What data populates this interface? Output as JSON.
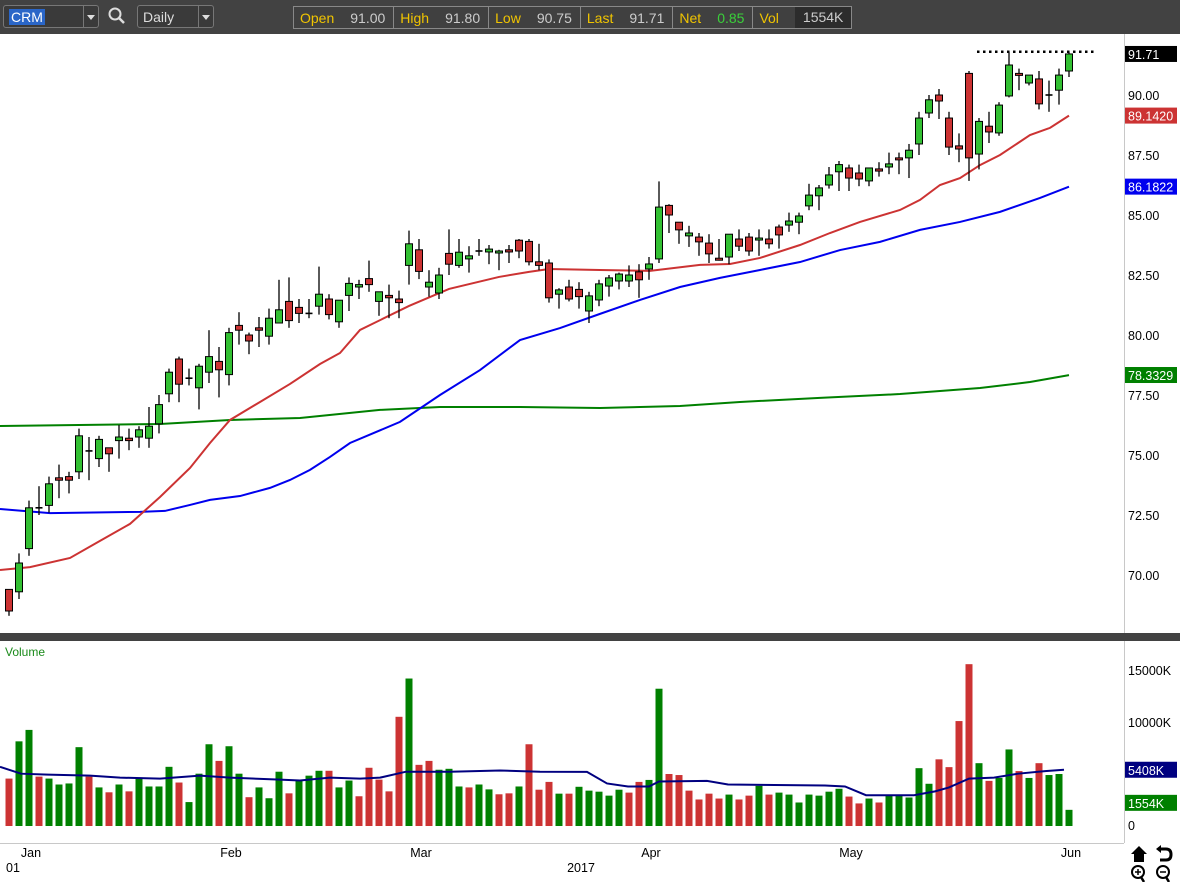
{
  "toolbar": {
    "symbol": "CRM",
    "interval": "Daily",
    "quote": {
      "open_label": "Open",
      "open": "91.00",
      "high_label": "High",
      "high": "91.80",
      "low_label": "Low",
      "low": "90.75",
      "last_label": "Last",
      "last": "91.71",
      "net_label": "Net",
      "net": "0.85",
      "vol_label": "Vol",
      "vol": "1554K"
    }
  },
  "colors": {
    "up": "#33c033",
    "down": "#cc3333",
    "vol_up": "#008000",
    "vol_down": "#cc3333",
    "ma20": "#cc3333",
    "ma50": "#0000ee",
    "ma200": "#008000",
    "vol_ma": "#000080"
  },
  "chart_data": {
    "type": "candlestick",
    "symbol": "CRM",
    "price_axis": {
      "ylim": [
        68,
        92.5
      ],
      "ticks": [
        "90.00",
        "87.50",
        "85.00",
        "82.50",
        "80.00",
        "77.50",
        "75.00",
        "72.50",
        "70.00"
      ],
      "tick_values": [
        90,
        87.5,
        85,
        82.5,
        80,
        77.5,
        75,
        72.5,
        70
      ]
    },
    "last_price_label": "91.71",
    "high_line": 91.8,
    "ma_labels": {
      "ma20": "89.1420",
      "ma50": "86.1822",
      "ma200": "78.3329"
    },
    "x_ticks": [
      {
        "label": "Jan",
        "index": 1
      },
      {
        "label": "Feb",
        "index": 21
      },
      {
        "label": "Mar",
        "index": 40
      },
      {
        "label": "Apr",
        "index": 63
      },
      {
        "label": "May",
        "index": 83
      },
      {
        "label": "Jun",
        "index": 105
      }
    ],
    "x_sublabels": [
      {
        "label": "01",
        "index": -0.8
      },
      {
        "label": "2017",
        "index": 56
      }
    ],
    "ohlc": [
      [
        69.4,
        69.4,
        68.3,
        68.5
      ],
      [
        69.3,
        70.9,
        69.0,
        70.5
      ],
      [
        71.1,
        73.1,
        70.8,
        72.8
      ],
      [
        72.8,
        73.7,
        72.5,
        72.8
      ],
      [
        72.9,
        74.1,
        72.6,
        73.8
      ],
      [
        74.05,
        74.6,
        73.2,
        73.95
      ],
      [
        74.1,
        74.3,
        73.4,
        73.95
      ],
      [
        74.3,
        76.1,
        74.0,
        75.8
      ],
      [
        75.17,
        75.75,
        73.95,
        75.17
      ],
      [
        74.85,
        75.8,
        74.5,
        75.65
      ],
      [
        75.3,
        75.3,
        74.3,
        75.05
      ],
      [
        75.6,
        76.25,
        74.85,
        75.75
      ],
      [
        75.7,
        76.1,
        75.2,
        75.6
      ],
      [
        75.75,
        76.2,
        75.3,
        76.05
      ],
      [
        75.7,
        77.0,
        75.3,
        76.2
      ],
      [
        76.3,
        77.5,
        75.9,
        77.1
      ],
      [
        77.55,
        78.6,
        77.2,
        78.45
      ],
      [
        79.0,
        79.1,
        77.2,
        77.95
      ],
      [
        78.2,
        78.6,
        77.9,
        78.2
      ],
      [
        77.8,
        78.8,
        76.9,
        78.7
      ],
      [
        78.45,
        80.2,
        78.0,
        79.1
      ],
      [
        78.9,
        79.5,
        77.4,
        78.55
      ],
      [
        78.35,
        80.3,
        77.9,
        80.1
      ],
      [
        80.4,
        80.95,
        79.6,
        80.2
      ],
      [
        80.0,
        80.1,
        79.2,
        79.75
      ],
      [
        80.3,
        80.75,
        79.5,
        80.2
      ],
      [
        79.95,
        81.1,
        79.6,
        80.7
      ],
      [
        80.5,
        82.3,
        80.5,
        81.05
      ],
      [
        81.4,
        82.4,
        80.3,
        80.6
      ],
      [
        81.15,
        81.5,
        80.5,
        80.9
      ],
      [
        80.9,
        81.5,
        80.7,
        80.9
      ],
      [
        81.2,
        82.85,
        80.85,
        81.7
      ],
      [
        81.5,
        81.7,
        80.65,
        80.85
      ],
      [
        80.55,
        81.45,
        80.3,
        81.45
      ],
      [
        81.65,
        82.4,
        81.0,
        82.15
      ],
      [
        82.0,
        82.3,
        81.5,
        82.1
      ],
      [
        82.35,
        83.1,
        81.8,
        82.1
      ],
      [
        81.4,
        81.8,
        80.8,
        81.8
      ],
      [
        81.65,
        82.1,
        80.7,
        81.55
      ],
      [
        81.5,
        81.85,
        80.7,
        81.35
      ],
      [
        82.9,
        84.35,
        82.1,
        83.8
      ],
      [
        83.55,
        84.0,
        82.33,
        82.65
      ],
      [
        82.0,
        82.7,
        81.6,
        82.2
      ],
      [
        81.75,
        82.8,
        81.5,
        82.5
      ],
      [
        83.4,
        84.4,
        82.5,
        82.95
      ],
      [
        82.9,
        84.0,
        82.8,
        83.45
      ],
      [
        83.17,
        83.7,
        82.6,
        83.3
      ],
      [
        83.5,
        84.0,
        83.3,
        83.5
      ],
      [
        83.46,
        83.75,
        82.95,
        83.58
      ],
      [
        83.42,
        83.55,
        82.7,
        83.5
      ],
      [
        83.55,
        83.75,
        83.0,
        83.46
      ],
      [
        83.95,
        84.0,
        83.2,
        83.5
      ],
      [
        83.9,
        84.0,
        82.9,
        83.05
      ],
      [
        83.05,
        83.8,
        82.7,
        82.9
      ],
      [
        83.0,
        83.15,
        81.35,
        81.55
      ],
      [
        81.7,
        81.95,
        81.1,
        81.88
      ],
      [
        82.0,
        82.3,
        81.4,
        81.5
      ],
      [
        81.9,
        82.2,
        81.1,
        81.6
      ],
      [
        81.0,
        81.8,
        80.5,
        81.63
      ],
      [
        81.46,
        82.3,
        81.2,
        82.13
      ],
      [
        82.04,
        82.5,
        81.6,
        82.38
      ],
      [
        82.25,
        82.6,
        81.9,
        82.54
      ],
      [
        82.25,
        82.9,
        82.0,
        82.5
      ],
      [
        82.63,
        82.95,
        81.55,
        82.3
      ],
      [
        82.75,
        83.25,
        82.3,
        82.96
      ],
      [
        83.17,
        86.4,
        83.0,
        85.33
      ],
      [
        85.4,
        85.45,
        84.25,
        85.0
      ],
      [
        84.7,
        84.7,
        83.8,
        84.38
      ],
      [
        84.13,
        84.55,
        83.67,
        84.25
      ],
      [
        84.08,
        84.25,
        83.3,
        83.88
      ],
      [
        83.83,
        84.2,
        83.0,
        83.38
      ],
      [
        83.2,
        84.0,
        83.1,
        83.13
      ],
      [
        83.25,
        84.2,
        82.95,
        84.2
      ],
      [
        84.0,
        84.4,
        83.5,
        83.7
      ],
      [
        84.08,
        84.25,
        83.3,
        83.5
      ],
      [
        83.96,
        84.4,
        83.3,
        84.04
      ],
      [
        84.0,
        84.4,
        83.6,
        83.8
      ],
      [
        84.5,
        84.6,
        83.6,
        84.17
      ],
      [
        84.58,
        85.1,
        84.3,
        84.75
      ],
      [
        84.7,
        85.1,
        84.2,
        84.96
      ],
      [
        85.38,
        86.3,
        85.2,
        85.83
      ],
      [
        85.8,
        86.25,
        85.2,
        86.13
      ],
      [
        86.25,
        87.0,
        86.1,
        86.67
      ],
      [
        86.8,
        87.25,
        86.0,
        87.1
      ],
      [
        86.96,
        87.1,
        86.0,
        86.54
      ],
      [
        86.75,
        87.1,
        86.2,
        86.5
      ],
      [
        86.42,
        86.96,
        86.2,
        86.96
      ],
      [
        86.92,
        87.2,
        86.6,
        86.83
      ],
      [
        87.0,
        87.6,
        86.7,
        87.13
      ],
      [
        87.38,
        87.6,
        86.7,
        87.3
      ],
      [
        87.38,
        87.96,
        86.54,
        87.7
      ],
      [
        87.96,
        89.3,
        87.5,
        89.04
      ],
      [
        89.25,
        90.0,
        89.04,
        89.8
      ],
      [
        90.0,
        90.25,
        89.0,
        89.75
      ],
      [
        89.04,
        89.3,
        87.5,
        87.83
      ],
      [
        87.88,
        88.4,
        87.2,
        87.75
      ],
      [
        90.9,
        91.0,
        86.42,
        87.38
      ],
      [
        87.54,
        89.04,
        86.9,
        88.9
      ],
      [
        88.7,
        89.3,
        88.0,
        88.46
      ],
      [
        88.42,
        89.7,
        88.3,
        89.58
      ],
      [
        89.96,
        91.8,
        89.9,
        91.25
      ],
      [
        90.9,
        91.1,
        90.2,
        90.83
      ],
      [
        90.5,
        90.83,
        90.4,
        90.83
      ],
      [
        90.67,
        91.0,
        89.4,
        89.63
      ],
      [
        90.0,
        90.6,
        89.3,
        90.0
      ],
      [
        90.2,
        91.1,
        89.6,
        90.83
      ],
      [
        91.0,
        91.8,
        90.75,
        91.71
      ]
    ],
    "ma20": [
      [
        -0.9,
        70.21
      ],
      [
        2.1,
        70.33
      ],
      [
        6.1,
        70.71
      ],
      [
        9.1,
        71.42
      ],
      [
        12.1,
        72.13
      ],
      [
        15.1,
        73.25
      ],
      [
        18.1,
        74.46
      ],
      [
        20.1,
        75.5
      ],
      [
        22.1,
        76.46
      ],
      [
        25.1,
        77.21
      ],
      [
        28.1,
        77.96
      ],
      [
        31.1,
        78.79
      ],
      [
        33.1,
        79.25
      ],
      [
        35.1,
        80.21
      ],
      [
        40,
        81.21
      ],
      [
        44,
        81.92
      ],
      [
        49,
        82.42
      ],
      [
        52,
        82.63
      ],
      [
        54,
        82.75
      ],
      [
        59.1,
        82.71
      ],
      [
        64.1,
        82.67
      ],
      [
        69.1,
        82.92
      ],
      [
        72.1,
        82.96
      ],
      [
        75.1,
        83.21
      ],
      [
        79.1,
        83.75
      ],
      [
        82.1,
        84.25
      ],
      [
        85.1,
        84.71
      ],
      [
        89.1,
        85.21
      ],
      [
        91.1,
        85.63
      ],
      [
        93.1,
        86.25
      ],
      [
        95.1,
        86.54
      ],
      [
        97.1,
        87.08
      ],
      [
        99.1,
        87.5
      ],
      [
        102.1,
        88.33
      ],
      [
        104.1,
        88.63
      ],
      [
        106,
        89.14
      ]
    ],
    "ma50": [
      [
        -0.9,
        72.75
      ],
      [
        4.1,
        72.58
      ],
      [
        13.1,
        72.63
      ],
      [
        15.6,
        72.67
      ],
      [
        18.1,
        72.92
      ],
      [
        20.1,
        73.13
      ],
      [
        23.1,
        73.29
      ],
      [
        26.1,
        73.63
      ],
      [
        28.1,
        73.96
      ],
      [
        30.1,
        74.38
      ],
      [
        32.1,
        74.92
      ],
      [
        34.1,
        75.5
      ],
      [
        39.1,
        76.38
      ],
      [
        43.1,
        77.5
      ],
      [
        47.1,
        78.54
      ],
      [
        51.1,
        79.79
      ],
      [
        55.1,
        80.29
      ],
      [
        59.1,
        80.88
      ],
      [
        63.1,
        81.46
      ],
      [
        67.1,
        82.0
      ],
      [
        71.1,
        82.38
      ],
      [
        75.1,
        82.71
      ],
      [
        79.1,
        83.04
      ],
      [
        83.1,
        83.54
      ],
      [
        87.1,
        83.88
      ],
      [
        91.1,
        84.38
      ],
      [
        95.1,
        84.71
      ],
      [
        99.1,
        85.13
      ],
      [
        103.1,
        85.71
      ],
      [
        106,
        86.18
      ]
    ],
    "ma200": [
      [
        -0.9,
        76.21
      ],
      [
        15.1,
        76.29
      ],
      [
        22.1,
        76.46
      ],
      [
        29.1,
        76.54
      ],
      [
        37.1,
        76.88
      ],
      [
        43.1,
        77.0
      ],
      [
        51.1,
        77.0
      ],
      [
        59.1,
        76.96
      ],
      [
        67.1,
        77.04
      ],
      [
        73.1,
        77.21
      ],
      [
        81.1,
        77.38
      ],
      [
        89.1,
        77.54
      ],
      [
        97.1,
        77.79
      ],
      [
        102.1,
        78.04
      ],
      [
        106,
        78.33
      ]
    ],
    "volume": {
      "title": "Volume",
      "ylim": [
        0,
        15000
      ],
      "ticks": [
        "15000K",
        "10000K",
        "0"
      ],
      "tick_values": [
        15000,
        10000,
        0
      ],
      "ma_label": "5408K",
      "last_label": "1554K",
      "up": [
        0,
        1,
        1,
        0,
        1,
        1,
        1,
        1,
        0,
        1,
        0,
        1,
        0,
        1,
        1,
        1,
        1,
        0,
        1,
        1,
        1,
        0,
        1,
        1,
        0,
        1,
        1,
        1,
        0,
        1,
        1,
        1,
        0,
        1,
        1,
        0,
        0,
        0,
        0,
        0,
        1,
        0,
        0,
        1,
        1,
        1,
        0,
        1,
        1,
        0,
        0,
        1,
        0,
        0,
        0,
        1,
        0,
        1,
        1,
        1,
        1,
        1,
        0,
        0,
        1,
        1,
        0,
        0,
        0,
        0,
        0,
        0,
        1,
        0,
        0,
        1,
        0,
        1,
        1,
        1,
        1,
        1,
        1,
        1,
        0,
        0,
        1,
        0,
        1,
        1,
        1,
        1,
        1,
        0,
        0,
        0,
        0,
        1,
        0,
        1,
        1,
        0,
        1,
        0,
        1,
        1,
        1
      ],
      "values_k": [
        4560,
        8140,
        9240,
        4750,
        4560,
        3990,
        4090,
        7580,
        4750,
        3710,
        3240,
        3990,
        3330,
        4560,
        3800,
        3800,
        5690,
        4180,
        2300,
        5030,
        7860,
        6260,
        7670,
        5030,
        2770,
        3710,
        2670,
        5220,
        3140,
        4370,
        4840,
        5310,
        5310,
        3710,
        4370,
        2860,
        5600,
        4460,
        3330,
        10500,
        14180,
        5880,
        6260,
        5410,
        5500,
        3800,
        3710,
        3990,
        3520,
        3050,
        3140,
        3800,
        7860,
        3490,
        4240,
        3110,
        3110,
        3770,
        3400,
        3300,
        2920,
        3490,
        3210,
        4240,
        4430,
        13200,
        5000,
        4900,
        3400,
        2550,
        3110,
        2640,
        3020,
        2550,
        2920,
        3870,
        3020,
        3210,
        3020,
        2260,
        3020,
        2920,
        3300,
        3580,
        2830,
        2170,
        2640,
        2260,
        2920,
        2920,
        2740,
        5560,
        4060,
        6410,
        5660,
        10090,
        15560,
        6040,
        4340,
        4620,
        7360,
        5280,
        4620,
        6040,
        4900,
        5000,
        1554
      ],
      "ma": [
        [
          -0.9,
          5690
        ],
        [
          1.2,
          5030
        ],
        [
          3.9,
          4940
        ],
        [
          8.1,
          4840
        ],
        [
          11.1,
          4650
        ],
        [
          15.1,
          4560
        ],
        [
          19.1,
          4840
        ],
        [
          22.1,
          4650
        ],
        [
          27.1,
          4460
        ],
        [
          29.1,
          4370
        ],
        [
          32.1,
          4650
        ],
        [
          35.1,
          4560
        ],
        [
          37.1,
          4650
        ],
        [
          39.7,
          5220
        ],
        [
          44.1,
          5220
        ],
        [
          49.1,
          5340
        ],
        [
          53.1,
          5220
        ],
        [
          57.8,
          5200
        ],
        [
          59.8,
          4090
        ],
        [
          61.9,
          3800
        ],
        [
          64,
          3800
        ],
        [
          65,
          4280
        ],
        [
          69.8,
          4340
        ],
        [
          71.9,
          3990
        ],
        [
          81.6,
          3900
        ],
        [
          83.6,
          3800
        ],
        [
          85.7,
          2960
        ],
        [
          90.5,
          2960
        ],
        [
          92.6,
          3330
        ],
        [
          94,
          3710
        ],
        [
          96,
          4560
        ],
        [
          98.5,
          4650
        ],
        [
          100.9,
          5030
        ],
        [
          103.6,
          5280
        ],
        [
          105.5,
          5410
        ]
      ]
    }
  }
}
